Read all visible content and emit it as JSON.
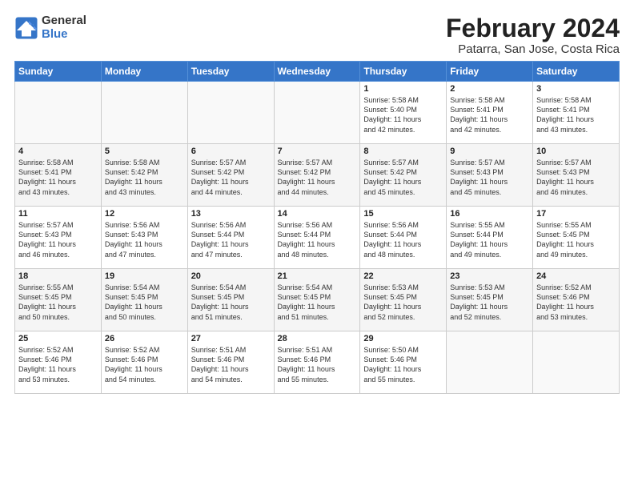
{
  "header": {
    "logo_general": "General",
    "logo_blue": "Blue",
    "month_year": "February 2024",
    "location": "Patarra, San Jose, Costa Rica"
  },
  "days_of_week": [
    "Sunday",
    "Monday",
    "Tuesday",
    "Wednesday",
    "Thursday",
    "Friday",
    "Saturday"
  ],
  "weeks": [
    [
      {
        "day": "",
        "info": ""
      },
      {
        "day": "",
        "info": ""
      },
      {
        "day": "",
        "info": ""
      },
      {
        "day": "",
        "info": ""
      },
      {
        "day": "1",
        "info": "Sunrise: 5:58 AM\nSunset: 5:40 PM\nDaylight: 11 hours\nand 42 minutes."
      },
      {
        "day": "2",
        "info": "Sunrise: 5:58 AM\nSunset: 5:41 PM\nDaylight: 11 hours\nand 42 minutes."
      },
      {
        "day": "3",
        "info": "Sunrise: 5:58 AM\nSunset: 5:41 PM\nDaylight: 11 hours\nand 43 minutes."
      }
    ],
    [
      {
        "day": "4",
        "info": "Sunrise: 5:58 AM\nSunset: 5:41 PM\nDaylight: 11 hours\nand 43 minutes."
      },
      {
        "day": "5",
        "info": "Sunrise: 5:58 AM\nSunset: 5:42 PM\nDaylight: 11 hours\nand 43 minutes."
      },
      {
        "day": "6",
        "info": "Sunrise: 5:57 AM\nSunset: 5:42 PM\nDaylight: 11 hours\nand 44 minutes."
      },
      {
        "day": "7",
        "info": "Sunrise: 5:57 AM\nSunset: 5:42 PM\nDaylight: 11 hours\nand 44 minutes."
      },
      {
        "day": "8",
        "info": "Sunrise: 5:57 AM\nSunset: 5:42 PM\nDaylight: 11 hours\nand 45 minutes."
      },
      {
        "day": "9",
        "info": "Sunrise: 5:57 AM\nSunset: 5:43 PM\nDaylight: 11 hours\nand 45 minutes."
      },
      {
        "day": "10",
        "info": "Sunrise: 5:57 AM\nSunset: 5:43 PM\nDaylight: 11 hours\nand 46 minutes."
      }
    ],
    [
      {
        "day": "11",
        "info": "Sunrise: 5:57 AM\nSunset: 5:43 PM\nDaylight: 11 hours\nand 46 minutes."
      },
      {
        "day": "12",
        "info": "Sunrise: 5:56 AM\nSunset: 5:43 PM\nDaylight: 11 hours\nand 47 minutes."
      },
      {
        "day": "13",
        "info": "Sunrise: 5:56 AM\nSunset: 5:44 PM\nDaylight: 11 hours\nand 47 minutes."
      },
      {
        "day": "14",
        "info": "Sunrise: 5:56 AM\nSunset: 5:44 PM\nDaylight: 11 hours\nand 48 minutes."
      },
      {
        "day": "15",
        "info": "Sunrise: 5:56 AM\nSunset: 5:44 PM\nDaylight: 11 hours\nand 48 minutes."
      },
      {
        "day": "16",
        "info": "Sunrise: 5:55 AM\nSunset: 5:44 PM\nDaylight: 11 hours\nand 49 minutes."
      },
      {
        "day": "17",
        "info": "Sunrise: 5:55 AM\nSunset: 5:45 PM\nDaylight: 11 hours\nand 49 minutes."
      }
    ],
    [
      {
        "day": "18",
        "info": "Sunrise: 5:55 AM\nSunset: 5:45 PM\nDaylight: 11 hours\nand 50 minutes."
      },
      {
        "day": "19",
        "info": "Sunrise: 5:54 AM\nSunset: 5:45 PM\nDaylight: 11 hours\nand 50 minutes."
      },
      {
        "day": "20",
        "info": "Sunrise: 5:54 AM\nSunset: 5:45 PM\nDaylight: 11 hours\nand 51 minutes."
      },
      {
        "day": "21",
        "info": "Sunrise: 5:54 AM\nSunset: 5:45 PM\nDaylight: 11 hours\nand 51 minutes."
      },
      {
        "day": "22",
        "info": "Sunrise: 5:53 AM\nSunset: 5:45 PM\nDaylight: 11 hours\nand 52 minutes."
      },
      {
        "day": "23",
        "info": "Sunrise: 5:53 AM\nSunset: 5:45 PM\nDaylight: 11 hours\nand 52 minutes."
      },
      {
        "day": "24",
        "info": "Sunrise: 5:52 AM\nSunset: 5:46 PM\nDaylight: 11 hours\nand 53 minutes."
      }
    ],
    [
      {
        "day": "25",
        "info": "Sunrise: 5:52 AM\nSunset: 5:46 PM\nDaylight: 11 hours\nand 53 minutes."
      },
      {
        "day": "26",
        "info": "Sunrise: 5:52 AM\nSunset: 5:46 PM\nDaylight: 11 hours\nand 54 minutes."
      },
      {
        "day": "27",
        "info": "Sunrise: 5:51 AM\nSunset: 5:46 PM\nDaylight: 11 hours\nand 54 minutes."
      },
      {
        "day": "28",
        "info": "Sunrise: 5:51 AM\nSunset: 5:46 PM\nDaylight: 11 hours\nand 55 minutes."
      },
      {
        "day": "29",
        "info": "Sunrise: 5:50 AM\nSunset: 5:46 PM\nDaylight: 11 hours\nand 55 minutes."
      },
      {
        "day": "",
        "info": ""
      },
      {
        "day": "",
        "info": ""
      }
    ]
  ]
}
